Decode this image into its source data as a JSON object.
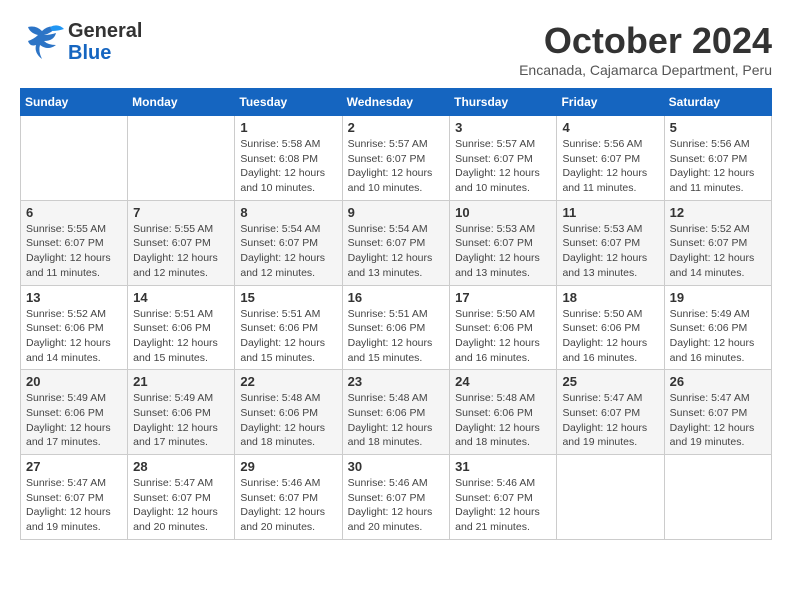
{
  "logo": {
    "line1": "General",
    "line2": "Blue"
  },
  "title": "October 2024",
  "subtitle": "Encanada, Cajamarca Department, Peru",
  "header_days": [
    "Sunday",
    "Monday",
    "Tuesday",
    "Wednesday",
    "Thursday",
    "Friday",
    "Saturday"
  ],
  "weeks": [
    [
      {
        "day": "",
        "info": ""
      },
      {
        "day": "",
        "info": ""
      },
      {
        "day": "1",
        "info": "Sunrise: 5:58 AM\nSunset: 6:08 PM\nDaylight: 12 hours and 10 minutes."
      },
      {
        "day": "2",
        "info": "Sunrise: 5:57 AM\nSunset: 6:07 PM\nDaylight: 12 hours and 10 minutes."
      },
      {
        "day": "3",
        "info": "Sunrise: 5:57 AM\nSunset: 6:07 PM\nDaylight: 12 hours and 10 minutes."
      },
      {
        "day": "4",
        "info": "Sunrise: 5:56 AM\nSunset: 6:07 PM\nDaylight: 12 hours and 11 minutes."
      },
      {
        "day": "5",
        "info": "Sunrise: 5:56 AM\nSunset: 6:07 PM\nDaylight: 12 hours and 11 minutes."
      }
    ],
    [
      {
        "day": "6",
        "info": "Sunrise: 5:55 AM\nSunset: 6:07 PM\nDaylight: 12 hours and 11 minutes."
      },
      {
        "day": "7",
        "info": "Sunrise: 5:55 AM\nSunset: 6:07 PM\nDaylight: 12 hours and 12 minutes."
      },
      {
        "day": "8",
        "info": "Sunrise: 5:54 AM\nSunset: 6:07 PM\nDaylight: 12 hours and 12 minutes."
      },
      {
        "day": "9",
        "info": "Sunrise: 5:54 AM\nSunset: 6:07 PM\nDaylight: 12 hours and 13 minutes."
      },
      {
        "day": "10",
        "info": "Sunrise: 5:53 AM\nSunset: 6:07 PM\nDaylight: 12 hours and 13 minutes."
      },
      {
        "day": "11",
        "info": "Sunrise: 5:53 AM\nSunset: 6:07 PM\nDaylight: 12 hours and 13 minutes."
      },
      {
        "day": "12",
        "info": "Sunrise: 5:52 AM\nSunset: 6:07 PM\nDaylight: 12 hours and 14 minutes."
      }
    ],
    [
      {
        "day": "13",
        "info": "Sunrise: 5:52 AM\nSunset: 6:06 PM\nDaylight: 12 hours and 14 minutes."
      },
      {
        "day": "14",
        "info": "Sunrise: 5:51 AM\nSunset: 6:06 PM\nDaylight: 12 hours and 15 minutes."
      },
      {
        "day": "15",
        "info": "Sunrise: 5:51 AM\nSunset: 6:06 PM\nDaylight: 12 hours and 15 minutes."
      },
      {
        "day": "16",
        "info": "Sunrise: 5:51 AM\nSunset: 6:06 PM\nDaylight: 12 hours and 15 minutes."
      },
      {
        "day": "17",
        "info": "Sunrise: 5:50 AM\nSunset: 6:06 PM\nDaylight: 12 hours and 16 minutes."
      },
      {
        "day": "18",
        "info": "Sunrise: 5:50 AM\nSunset: 6:06 PM\nDaylight: 12 hours and 16 minutes."
      },
      {
        "day": "19",
        "info": "Sunrise: 5:49 AM\nSunset: 6:06 PM\nDaylight: 12 hours and 16 minutes."
      }
    ],
    [
      {
        "day": "20",
        "info": "Sunrise: 5:49 AM\nSunset: 6:06 PM\nDaylight: 12 hours and 17 minutes."
      },
      {
        "day": "21",
        "info": "Sunrise: 5:49 AM\nSunset: 6:06 PM\nDaylight: 12 hours and 17 minutes."
      },
      {
        "day": "22",
        "info": "Sunrise: 5:48 AM\nSunset: 6:06 PM\nDaylight: 12 hours and 18 minutes."
      },
      {
        "day": "23",
        "info": "Sunrise: 5:48 AM\nSunset: 6:06 PM\nDaylight: 12 hours and 18 minutes."
      },
      {
        "day": "24",
        "info": "Sunrise: 5:48 AM\nSunset: 6:06 PM\nDaylight: 12 hours and 18 minutes."
      },
      {
        "day": "25",
        "info": "Sunrise: 5:47 AM\nSunset: 6:07 PM\nDaylight: 12 hours and 19 minutes."
      },
      {
        "day": "26",
        "info": "Sunrise: 5:47 AM\nSunset: 6:07 PM\nDaylight: 12 hours and 19 minutes."
      }
    ],
    [
      {
        "day": "27",
        "info": "Sunrise: 5:47 AM\nSunset: 6:07 PM\nDaylight: 12 hours and 19 minutes."
      },
      {
        "day": "28",
        "info": "Sunrise: 5:47 AM\nSunset: 6:07 PM\nDaylight: 12 hours and 20 minutes."
      },
      {
        "day": "29",
        "info": "Sunrise: 5:46 AM\nSunset: 6:07 PM\nDaylight: 12 hours and 20 minutes."
      },
      {
        "day": "30",
        "info": "Sunrise: 5:46 AM\nSunset: 6:07 PM\nDaylight: 12 hours and 20 minutes."
      },
      {
        "day": "31",
        "info": "Sunrise: 5:46 AM\nSunset: 6:07 PM\nDaylight: 12 hours and 21 minutes."
      },
      {
        "day": "",
        "info": ""
      },
      {
        "day": "",
        "info": ""
      }
    ]
  ]
}
